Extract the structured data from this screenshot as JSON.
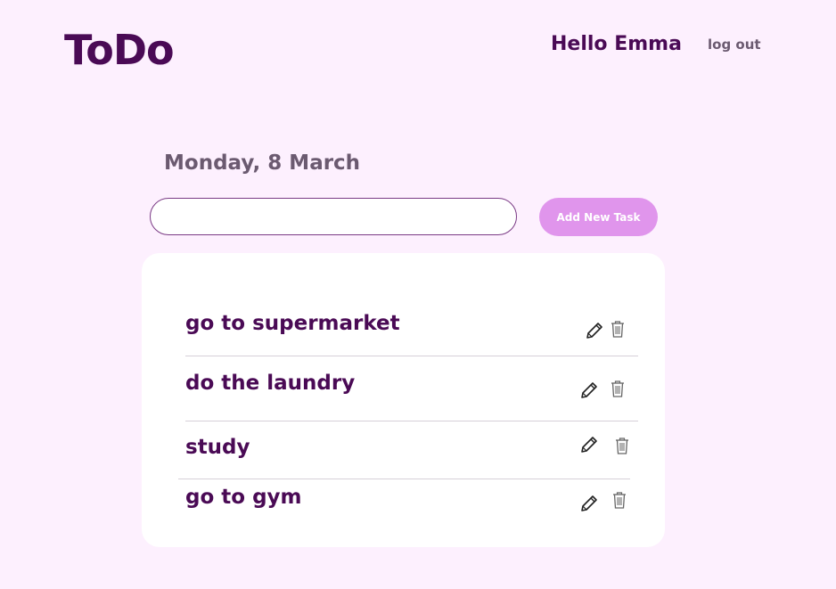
{
  "header": {
    "logo": "ToDo",
    "greeting": "Hello Emma",
    "logout_label": "log out"
  },
  "main": {
    "date": "Monday, 8 March",
    "new_task_input": {
      "value": "",
      "placeholder": ""
    },
    "add_button_label": "Add New Task"
  },
  "tasks": [
    {
      "label": "go to supermarket",
      "edit_icon": "pencil-icon",
      "delete_icon": "trash-icon"
    },
    {
      "label": "do the laundry",
      "edit_icon": "pencil-icon",
      "delete_icon": "trash-icon"
    },
    {
      "label": "study",
      "edit_icon": "pencil-icon",
      "delete_icon": "trash-icon"
    },
    {
      "label": "go to gym",
      "edit_icon": "pencil-icon",
      "delete_icon": "trash-icon"
    }
  ],
  "colors": {
    "background": "#fdf0fe",
    "brand": "#4a0a55",
    "muted_text": "#6b5a70",
    "button": "#e095ec",
    "card": "#ffffff"
  }
}
